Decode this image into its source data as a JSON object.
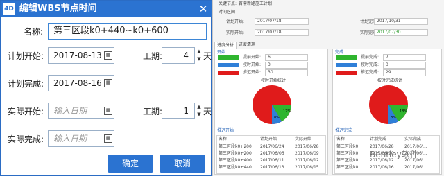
{
  "dialog": {
    "logo_text": "4D",
    "title": "编辑WBS节点时间",
    "close_glyph": "✕",
    "name_label": "名称:",
    "name_value": "第三区段k0+440~k0+600",
    "plan_start_label": "计划开始:",
    "plan_start_value": "2017-08-13",
    "duration_label": "工期:",
    "plan_duration_value": "4",
    "day_unit": "天",
    "plan_end_label": "计划完成:",
    "plan_end_value": "2017-08-16",
    "actual_start_label": "实际开始:",
    "actual_start_placeholder": "输入日期",
    "actual_duration_value": "1",
    "actual_end_label": "实际完成:",
    "actual_end_placeholder": "输入日期",
    "ok_label": "确定",
    "cancel_label": "取消",
    "calendar_icon": "calendar-icon",
    "spinner_up": "▲",
    "spinner_down": "▼"
  },
  "side": {
    "header_label_a": "关键节点:",
    "header_label_b": "首套新路施工计划",
    "time_section": "时间区间",
    "plan_start_label": "计划开始:",
    "plan_start_value": "2017/07/18",
    "plan_end_label": "计划完成:",
    "plan_end_value": "2017/10/31",
    "actual_start_label": "实际开始:",
    "actual_start_value": "2017/07/18",
    "actual_end_label": "实际完成:",
    "actual_end_value": "2017/07/30",
    "tab_a": "进度分析",
    "tab_b": "进度清理",
    "left_panel": {
      "title": "开始",
      "legend": [
        {
          "label": "提前开始:",
          "value": "6",
          "color": "#2fb52f"
        },
        {
          "label": "按时开始:",
          "value": "3",
          "color": "#2f7fd8"
        },
        {
          "label": "推迟开始:",
          "value": "30",
          "color": "#e01b1b"
        }
      ],
      "chart_title": "按时开始统计",
      "pie_labels": [
        "17%",
        "8%"
      ],
      "table_title": "推迟开始",
      "columns": [
        "名称",
        "计划开始",
        "实际开始"
      ],
      "rows": [
        [
          "第三区段k0+200",
          "2017/06/24",
          "2017/06/28"
        ],
        [
          "第三区段k0+200",
          "2017/06/06",
          "2017/06/09"
        ],
        [
          "第三区段k0+400",
          "2017/06/11",
          "2017/06/12"
        ],
        [
          "第三区段k0+440",
          "2017/06/13",
          "2017/06/15"
        ]
      ]
    },
    "right_panel": {
      "title": "完成",
      "legend": [
        {
          "label": "提前完成:",
          "value": "7",
          "color": "#2fb52f"
        },
        {
          "label": "按时完成:",
          "value": "3",
          "color": "#2f7fd8"
        },
        {
          "label": "推迟完成:",
          "value": "29",
          "color": "#e01b1b"
        }
      ],
      "chart_title": "按时完成统计",
      "pie_labels": [
        "18%",
        "8%"
      ],
      "table_title": "推迟完成",
      "columns": [
        "名称",
        "计划完成",
        "实际完成"
      ],
      "rows": [
        [
          "第三区段k0",
          "2017/06/28",
          "2017/06/..."
        ],
        [
          "第三区段k0",
          "2017/06/10",
          "2017/06/..."
        ],
        [
          "第三区段k0",
          "2017/06/12",
          "2017/06/..."
        ],
        [
          "第三区段k0",
          "2017/06/16",
          "2017/06/..."
        ]
      ]
    },
    "watermark": "Bentley软件"
  }
}
